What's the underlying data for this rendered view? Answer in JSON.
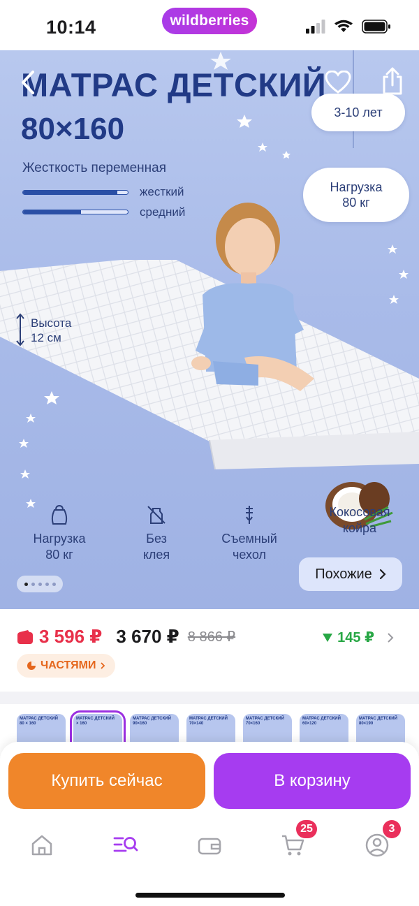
{
  "status_bar": {
    "time": "10:14",
    "brand": "wildberries"
  },
  "hero": {
    "title": "МАТРАС ДЕТСКИЙ",
    "size": "80×160",
    "stiffness_title": "Жесткость переменная",
    "bars": [
      {
        "label": "жесткий",
        "level": 0.9
      },
      {
        "label": "средний",
        "level": 0.55
      }
    ],
    "height_label": "Высота",
    "height_value": "12 см",
    "age_cloud": "3-10 лет",
    "load_cloud_line1": "Нагрузка",
    "load_cloud_line2": "80 кг",
    "features": [
      {
        "icon": "weight-icon",
        "line1": "Нагрузка",
        "line2": "80 кг"
      },
      {
        "icon": "no-glue-icon",
        "line1": "Без",
        "line2": "клея"
      },
      {
        "icon": "zipper-icon",
        "line1": "Съемный",
        "line2": "чехол"
      },
      {
        "icon": "coconut-icon",
        "line1": "Кокосовая",
        "line2": "койра"
      }
    ],
    "similar_label": "Похожие",
    "gallery": {
      "count": 5,
      "active_index": 0
    }
  },
  "price": {
    "wallet_price": "3 596 ₽",
    "price": "3 670 ₽",
    "old_price": "8 866 ₽",
    "drop": "145 ₽",
    "installments": "ЧАСТЯМИ"
  },
  "thumbnails": [
    {
      "title": "МАТРАС ДЕТСКИЙ",
      "size": "80 × 160",
      "selected": false
    },
    {
      "title": "МАТРАС ДЕТСКИЙ",
      "size": "× 160",
      "selected": true
    },
    {
      "title": "МАТРАС ДЕТСКИЙ",
      "size": "90×160",
      "selected": false
    },
    {
      "title": "МАТРАС ДЕТСКИЙ",
      "size": "70×140",
      "selected": false
    },
    {
      "title": "МАТРАС ДЕТСКИЙ",
      "size": "70×160",
      "selected": false
    },
    {
      "title": "МАТРАС ДЕТСКИЙ",
      "size": "60×120",
      "selected": false
    },
    {
      "title": "МАТРАС ДЕТСКИЙ",
      "size": "80×190",
      "selected": false
    }
  ],
  "actions": {
    "buy_now": "Купить сейчас",
    "add_to_cart": "В корзину"
  },
  "tabbar": {
    "cart_badge": "25",
    "profile_badge": "3"
  },
  "colors": {
    "accent": "#a63cf0",
    "buy": "#f0862a",
    "price_red": "#e8304a",
    "drop_green": "#28a745",
    "hero_text": "#213a86"
  }
}
